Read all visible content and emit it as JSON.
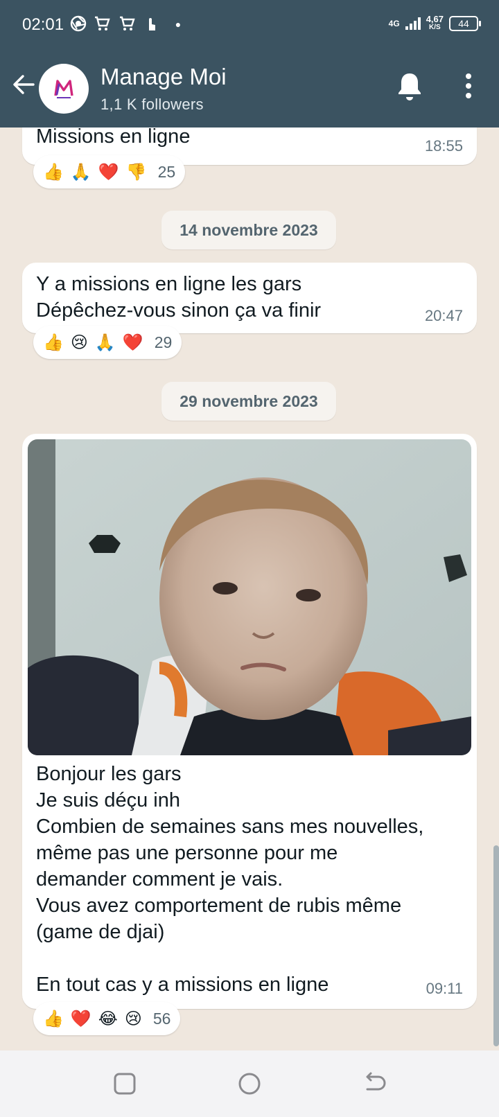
{
  "status_bar": {
    "time": "02:01",
    "network": "4G",
    "speed_value": "4,67",
    "speed_unit": "K/S",
    "battery": "44"
  },
  "header": {
    "title": "Manage Moi",
    "subtitle": "1,1 K followers"
  },
  "messages": [
    {
      "text": "Missions en ligne",
      "time": "18:55",
      "reactions": [
        "👍",
        "🙏",
        "❤️",
        "👎"
      ],
      "reaction_count": "25"
    },
    {
      "date": "14 novembre 2023"
    },
    {
      "text": "Y a missions en ligne les gars\nDépêchez-vous sinon ça va finir",
      "time": "20:47",
      "reactions": [
        "👍",
        "😢",
        "🙏",
        "❤️"
      ],
      "reaction_count": "29"
    },
    {
      "date": "29 novembre 2023"
    },
    {
      "image": "baby-photo",
      "text": "Bonjour les gars\nJe suis déçu inh\nCombien de semaines sans mes nouvelles,\nmême pas une personne pour me\ndemander comment je vais.\nVous avez comportement de rubis même\n(game de djai)\n\nEn tout cas y a missions en ligne",
      "time": "09:11",
      "reactions": [
        "👍",
        "❤️",
        "😂",
        "😢"
      ],
      "reaction_count": "56"
    }
  ],
  "icons": {
    "back": "arrow-left-icon",
    "notifications": "bell-icon",
    "menu": "more-vertical-icon",
    "nav_recents": "square-icon",
    "nav_home": "circle-icon",
    "nav_back": "back-arrow-icon"
  },
  "colors": {
    "header": "#3b5361",
    "chat_background": "#efe7de",
    "bubble": "#ffffff",
    "timestamp": "#667781"
  }
}
